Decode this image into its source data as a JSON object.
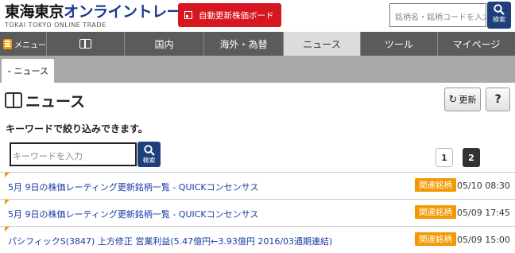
{
  "header": {
    "logo_main_black": "東海東京",
    "logo_main_blue": "オンライントレード",
    "logo_sub": "TOKAI TOKYO ONLINE TRADE",
    "board_button": "自動更新株価ボード",
    "search_placeholder": "銘柄名・銘柄コードを入力",
    "search_button": "検索"
  },
  "nav": {
    "menu": "メニュー",
    "items": [
      "国内",
      "海外・為替",
      "ニュース",
      "ツール",
      "マイページ"
    ],
    "active": "ニュース"
  },
  "subnav": {
    "tab": "ニュース"
  },
  "main": {
    "title": "ニュース",
    "refresh": "更新",
    "help": "?",
    "filter_label": "キーワードで絞り込みできます。",
    "keyword_placeholder": "キーワードを入力",
    "keyword_button": "検索",
    "pages": [
      "1",
      "2"
    ],
    "current_page": "2"
  },
  "news": [
    {
      "headline": "5月 9日の株価レーティング更新銘柄一覧 - QUICKコンセンサス",
      "badge": "関連銘柄",
      "time": "05/10 08:30"
    },
    {
      "headline": "5月 9日の株価レーティング更新銘柄一覧 - QUICKコンセンサス",
      "badge": "関連銘柄",
      "time": "05/09 17:45"
    },
    {
      "headline": "パシフィックS(3847) 上方修正 営業利益(5.47億円←3.93億円 2016/03通期連結)",
      "badge": "関連銘柄",
      "time": "05/09 15:00"
    }
  ],
  "colors": {
    "accent": "#f39800",
    "brand_blue": "#1e3f7a",
    "red": "#d7171f",
    "link": "#1a3aa8"
  }
}
